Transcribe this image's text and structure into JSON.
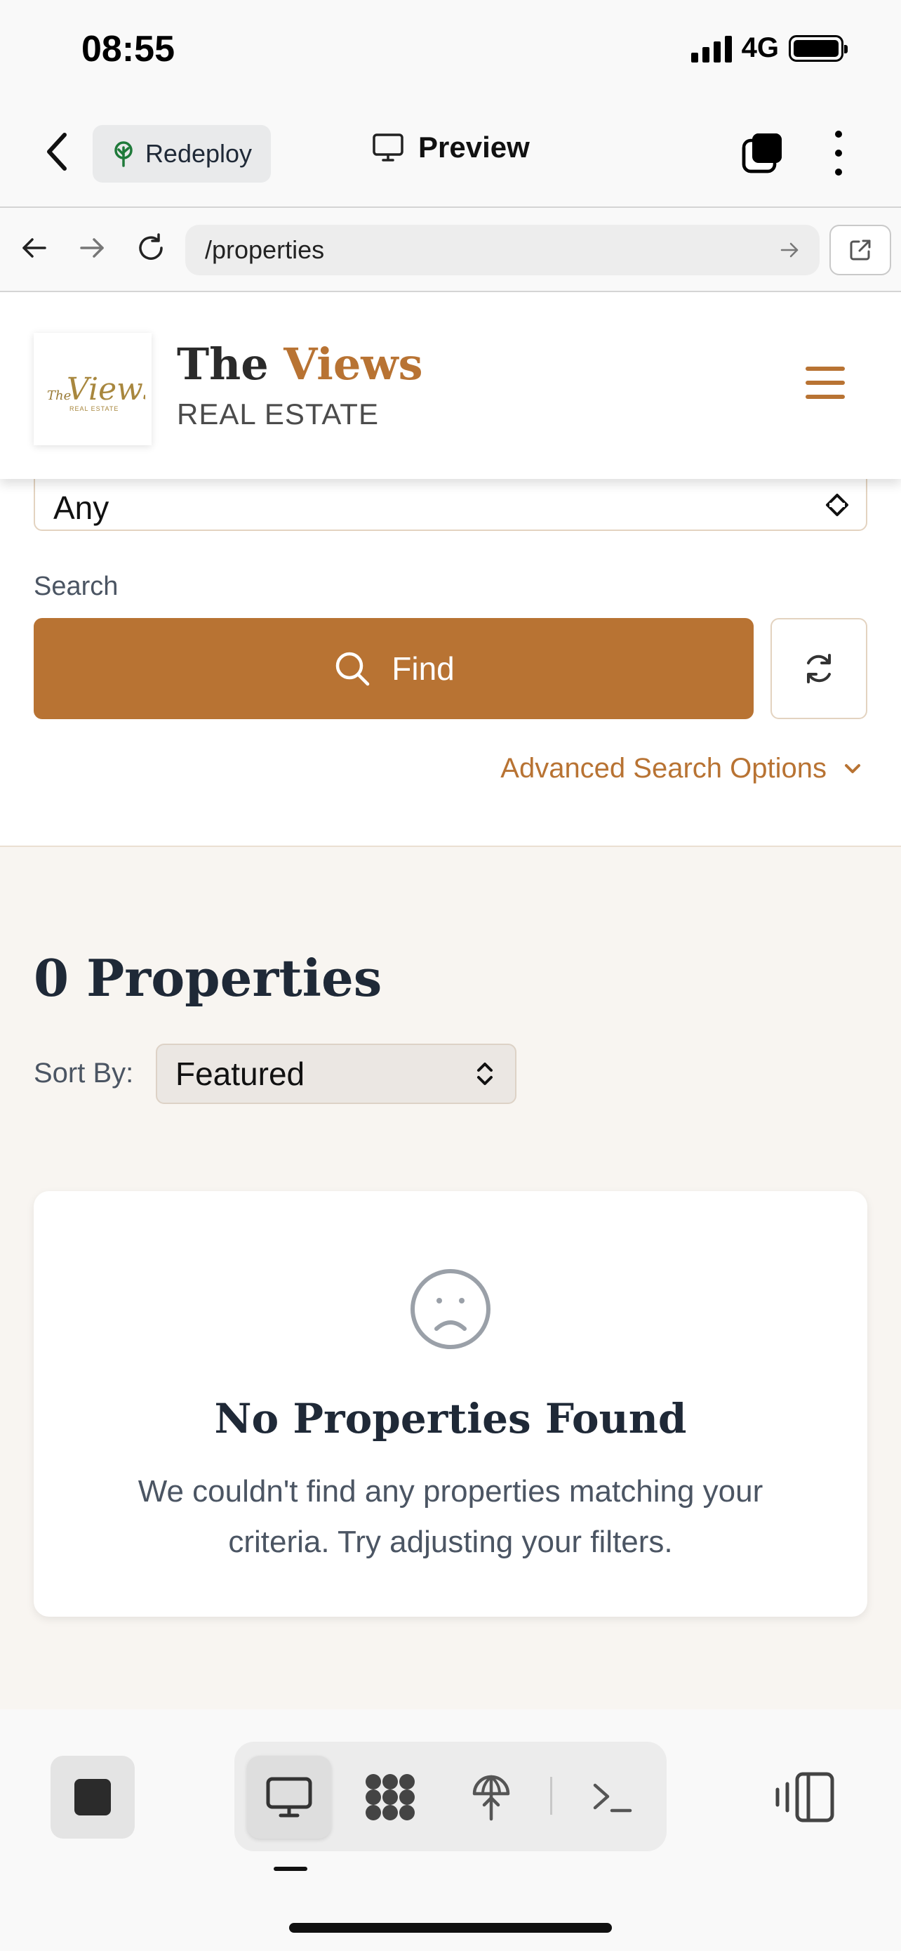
{
  "status_bar": {
    "time": "08:55",
    "network": "4G"
  },
  "toolbar": {
    "redeploy_label": "Redeploy",
    "preview_label": "Preview"
  },
  "browser": {
    "url": "/properties"
  },
  "site": {
    "brand_name_1": "The",
    "brand_name_2": "Views",
    "brand_sub": "REAL ESTATE",
    "logo_text_1": "The",
    "logo_text_2": "Views",
    "logo_text_3": "REAL ESTATE",
    "accent_color": "#b87333"
  },
  "search": {
    "select_value": "Any",
    "label": "Search",
    "find_label": "Find",
    "advanced_label": "Advanced Search Options"
  },
  "results": {
    "heading": "0 Properties",
    "sort_label": "Sort By:",
    "sort_value": "Featured",
    "empty_title": "No Properties Found",
    "empty_text": "We couldn't find any properties matching your criteria. Try adjusting your filters."
  },
  "icons": [
    "back-icon",
    "tree-icon",
    "monitor-icon",
    "tabs-icon",
    "more-icon",
    "arrow-left-icon",
    "arrow-right-icon",
    "reload-icon",
    "arrow-go-icon",
    "external-link-icon",
    "hamburger-icon",
    "chevron-updown-icon",
    "search-icon",
    "refresh-icon",
    "chevron-down-icon",
    "sad-face-icon",
    "stop-icon",
    "desktop-icon",
    "grid-icon",
    "globe-icon",
    "terminal-icon",
    "side-panel-icon"
  ]
}
